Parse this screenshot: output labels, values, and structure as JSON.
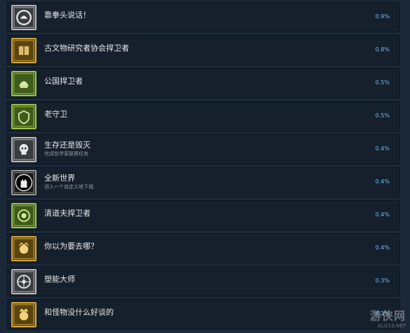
{
  "achievements": [
    {
      "title": "靠拳头说话！",
      "desc": "",
      "percent": "0.9%",
      "icon": "fist-icon",
      "frame": "silver"
    },
    {
      "title": "古文物研究者协会捍卫者",
      "desc": "",
      "percent": "0.8%",
      "icon": "book-icon",
      "frame": "gold"
    },
    {
      "title": "公国捍卫者",
      "desc": "",
      "percent": "0.5%",
      "icon": "helmet-icon",
      "frame": "green"
    },
    {
      "title": "老守卫",
      "desc": "",
      "percent": "0.5%",
      "icon": "shield-icon",
      "frame": "green"
    },
    {
      "title": "生存还是毁灭",
      "desc": "完成哲学家联赛任务",
      "percent": "0.4%",
      "icon": "skull-icon",
      "frame": "silver"
    },
    {
      "title": "全新世界",
      "desc": "进入一个自定义地下城",
      "percent": "0.4%",
      "icon": "tower-icon",
      "frame": "dark"
    },
    {
      "title": "清道夫捍卫者",
      "desc": "",
      "percent": "0.4%",
      "icon": "badge-icon",
      "frame": "green"
    },
    {
      "title": "你以为要去哪？",
      "desc": "",
      "percent": "0.4%",
      "icon": "face-icon",
      "frame": "gold"
    },
    {
      "title": "塑能大师",
      "desc": "",
      "percent": "0.3%",
      "icon": "wheel-icon",
      "frame": "silver"
    },
    {
      "title": "和怪物没什么好谈的",
      "desc": "",
      "percent": "0.3%",
      "icon": "crowned-face-icon",
      "frame": "gold"
    }
  ],
  "watermark": {
    "main": "游侠网",
    "sub": "ALI213.NET"
  },
  "colors": {
    "background": "#1b2838",
    "row": "#16202d",
    "percent": "#66c0f4"
  }
}
